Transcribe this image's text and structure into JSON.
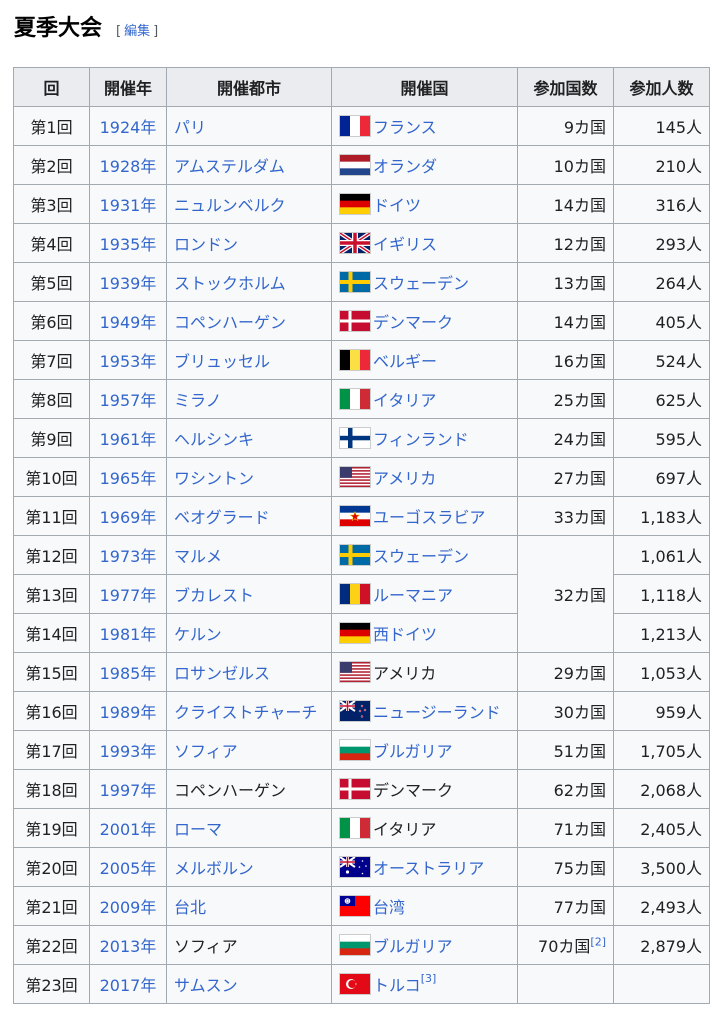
{
  "section": {
    "title": "夏季大会",
    "edit_open": "[",
    "edit_label": "編集",
    "edit_close": "]"
  },
  "table": {
    "headers": [
      "回",
      "開催年",
      "開催都市",
      "開催国",
      "参加国数",
      "参加人数"
    ],
    "rows": [
      {
        "no": "第1回",
        "year": "1924年",
        "city": "パリ",
        "city_link": true,
        "country": "フランス",
        "country_link": true,
        "flag": "france-flag-icon",
        "nations": "9カ国",
        "people": "145人"
      },
      {
        "no": "第2回",
        "year": "1928年",
        "city": "アムステルダム",
        "city_link": true,
        "country": "オランダ",
        "country_link": true,
        "flag": "netherlands-flag-icon",
        "nations": "10カ国",
        "people": "210人"
      },
      {
        "no": "第3回",
        "year": "1931年",
        "city": "ニュルンベルク",
        "city_link": true,
        "country": "ドイツ",
        "country_link": true,
        "flag": "germany-flag-icon",
        "nations": "14カ国",
        "people": "316人"
      },
      {
        "no": "第4回",
        "year": "1935年",
        "city": "ロンドン",
        "city_link": true,
        "country": "イギリス",
        "country_link": true,
        "flag": "uk-flag-icon",
        "nations": "12カ国",
        "people": "293人"
      },
      {
        "no": "第5回",
        "year": "1939年",
        "city": "ストックホルム",
        "city_link": true,
        "country": "スウェーデン",
        "country_link": true,
        "flag": "sweden-flag-icon",
        "nations": "13カ国",
        "people": "264人"
      },
      {
        "no": "第6回",
        "year": "1949年",
        "city": "コペンハーゲン",
        "city_link": true,
        "country": "デンマーク",
        "country_link": true,
        "flag": "denmark-flag-icon",
        "nations": "14カ国",
        "people": "405人"
      },
      {
        "no": "第7回",
        "year": "1953年",
        "city": "ブリュッセル",
        "city_link": true,
        "country": "ベルギー",
        "country_link": true,
        "flag": "belgium-flag-icon",
        "nations": "16カ国",
        "people": "524人"
      },
      {
        "no": "第8回",
        "year": "1957年",
        "city": "ミラノ",
        "city_link": true,
        "country": "イタリア",
        "country_link": true,
        "flag": "italy-flag-icon",
        "nations": "25カ国",
        "people": "625人"
      },
      {
        "no": "第9回",
        "year": "1961年",
        "city": "ヘルシンキ",
        "city_link": true,
        "country": "フィンランド",
        "country_link": true,
        "flag": "finland-flag-icon",
        "nations": "24カ国",
        "people": "595人"
      },
      {
        "no": "第10回",
        "year": "1965年",
        "city": "ワシントン",
        "city_link": true,
        "country": "アメリカ",
        "country_link": true,
        "flag": "usa-flag-icon",
        "nations": "27カ国",
        "people": "697人"
      },
      {
        "no": "第11回",
        "year": "1969年",
        "city": "ベオグラード",
        "city_link": true,
        "country": "ユーゴスラビア",
        "country_link": true,
        "flag": "yugoslavia-flag-icon",
        "nations": "33カ国",
        "people": "1,183人"
      },
      {
        "no": "第12回",
        "year": "1973年",
        "city": "マルメ",
        "city_link": true,
        "country": "スウェーデン",
        "country_link": true,
        "flag": "sweden-flag-icon",
        "nations": "32カ国",
        "people": "1,061人"
      },
      {
        "no": "第13回",
        "year": "1977年",
        "city": "ブカレスト",
        "city_link": true,
        "country": "ルーマニア",
        "country_link": true,
        "flag": "romania-flag-icon",
        "nations": "",
        "people": "1,118人"
      },
      {
        "no": "第14回",
        "year": "1981年",
        "city": "ケルン",
        "city_link": true,
        "country": "西ドイツ",
        "country_link": true,
        "flag": "germany-flag-icon",
        "nations": "",
        "people": "1,213人"
      },
      {
        "no": "第15回",
        "year": "1985年",
        "city": "ロサンゼルス",
        "city_link": true,
        "country": "アメリカ",
        "country_link": false,
        "flag": "usa-flag-icon",
        "nations": "29カ国",
        "people": "1,053人"
      },
      {
        "no": "第16回",
        "year": "1989年",
        "city": "クライストチャーチ",
        "city_link": true,
        "country": "ニュージーランド",
        "country_link": true,
        "flag": "newzealand-flag-icon",
        "nations": "30カ国",
        "people": "959人"
      },
      {
        "no": "第17回",
        "year": "1993年",
        "city": "ソフィア",
        "city_link": true,
        "country": "ブルガリア",
        "country_link": true,
        "flag": "bulgaria-flag-icon",
        "nations": "51カ国",
        "people": "1,705人"
      },
      {
        "no": "第18回",
        "year": "1997年",
        "city": "コペンハーゲン",
        "city_link": false,
        "country": "デンマーク",
        "country_link": false,
        "flag": "denmark-flag-icon",
        "nations": "62カ国",
        "people": "2,068人"
      },
      {
        "no": "第19回",
        "year": "2001年",
        "city": "ローマ",
        "city_link": true,
        "country": "イタリア",
        "country_link": false,
        "flag": "italy-flag-icon",
        "nations": "71カ国",
        "people": "2,405人"
      },
      {
        "no": "第20回",
        "year": "2005年",
        "city": "メルボルン",
        "city_link": true,
        "country": "オーストラリア",
        "country_link": true,
        "flag": "australia-flag-icon",
        "nations": "75カ国",
        "people": "3,500人"
      },
      {
        "no": "第21回",
        "year": "2009年",
        "city": "台北",
        "city_link": true,
        "country": "台湾",
        "country_link": true,
        "flag": "taiwan-flag-icon",
        "nations": "77カ国",
        "people": "2,493人"
      },
      {
        "no": "第22回",
        "year": "2013年",
        "city": "ソフィア",
        "city_link": false,
        "country": "ブルガリア",
        "country_link": true,
        "flag": "bulgaria-flag-icon",
        "nations": "70カ国",
        "nations_ref": "[2]",
        "people": "2,879人"
      },
      {
        "no": "第23回",
        "year": "2017年",
        "city": "サムスン",
        "city_link": true,
        "country": "トルコ",
        "country_link": true,
        "country_ref": "[3]",
        "flag": "turkey-flag-icon",
        "nations": "",
        "people": ""
      }
    ]
  }
}
